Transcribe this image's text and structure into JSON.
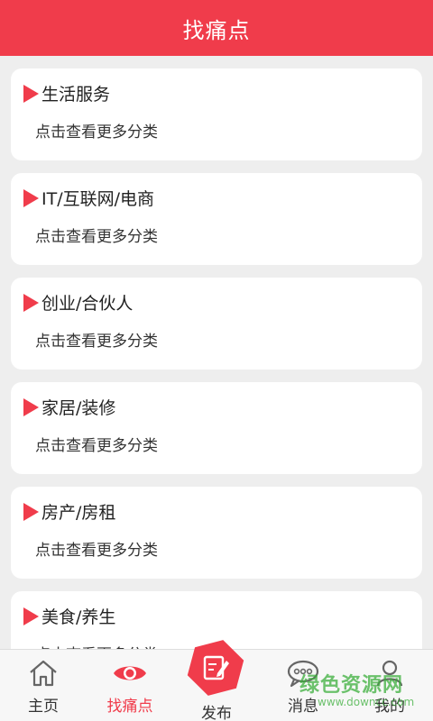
{
  "header": {
    "title": "找痛点"
  },
  "cards": [
    {
      "title": "生活服务",
      "subtitle": "点击查看更多分类"
    },
    {
      "title": "IT/互联网/电商",
      "subtitle": "点击查看更多分类"
    },
    {
      "title": "创业/合伙人",
      "subtitle": "点击查看更多分类"
    },
    {
      "title": "家居/装修",
      "subtitle": "点击查看更多分类"
    },
    {
      "title": "房产/房租",
      "subtitle": "点击查看更多分类"
    },
    {
      "title": "美食/养生",
      "subtitle": "点击查看更多分类"
    }
  ],
  "nav": {
    "home": {
      "label": "主页",
      "icon": "home-icon"
    },
    "find": {
      "label": "找痛点",
      "icon": "eye-icon",
      "active": true
    },
    "publish": {
      "label": "发布",
      "icon": "edit-icon"
    },
    "messages": {
      "label": "消息",
      "icon": "chat-bubble-icon"
    },
    "mine": {
      "label": "我的",
      "icon": "user-icon"
    }
  },
  "watermark": {
    "main": "绿色资源网",
    "sub": "www.downcc.com"
  },
  "colors": {
    "accent": "#f03c4b",
    "background": "#eeeeee",
    "card": "#ffffff",
    "watermark": "#3caf3c"
  }
}
